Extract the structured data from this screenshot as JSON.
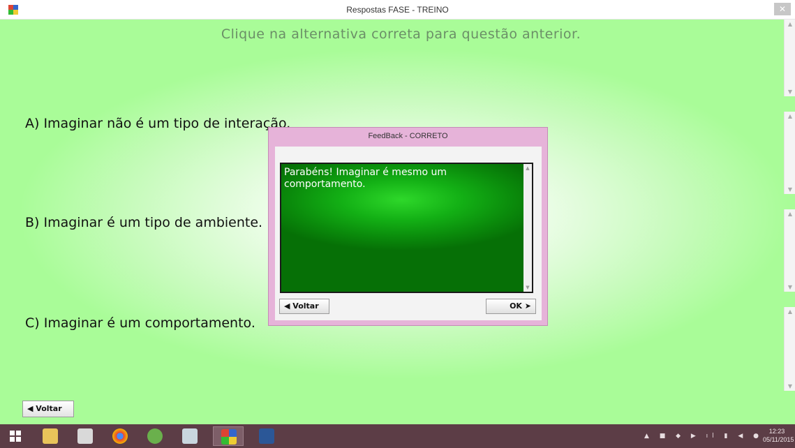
{
  "window": {
    "title": "Respostas FASE - TREINO",
    "close_glyph": "✕"
  },
  "main": {
    "question_title": "Clique na alternativa correta para questão anterior.",
    "alternatives": [
      "A) Imaginar não é um tipo de interação.",
      "B) Imaginar é um tipo de ambiente.",
      "C) Imaginar é um comportamento."
    ],
    "voltar_label": "◀ Voltar"
  },
  "dialog": {
    "title": "FeedBack - CORRETO",
    "message": "Parabéns! Imaginar é mesmo um comportamento.",
    "voltar_label": "◀ Voltar",
    "ok_label": "OK ➤"
  },
  "taskbar": {
    "items": [
      "start-icon",
      "file-explorer-icon",
      "calendar-app-icon",
      "chrome-icon",
      "utorrent-icon",
      "calculator-icon",
      "active-app-icon",
      "word-icon"
    ],
    "tray_icons": "▲ ■ ◆ ▶ ıl ▮ ◀ ●",
    "time": "12:23",
    "date": "05/11/2015"
  },
  "colors": {
    "background_green": "#a9fc98",
    "dialog_pink": "#e6b3d9",
    "feedback_green": "#0a8a0b",
    "taskbar": "#5c3d46"
  }
}
